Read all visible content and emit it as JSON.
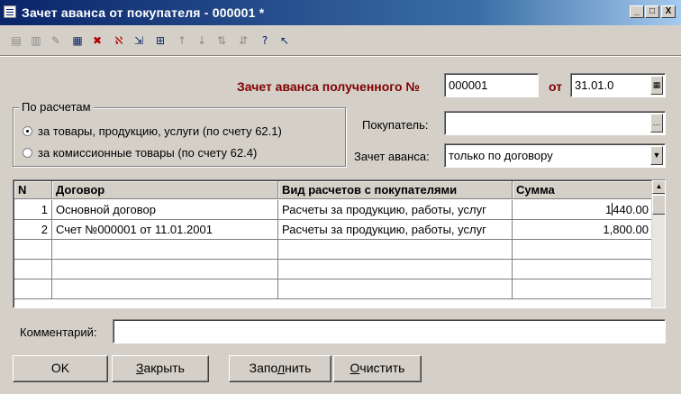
{
  "window": {
    "title": "Зачет аванса от покупателя - 000001 *",
    "controls": {
      "minimize": "_",
      "maximize": "□",
      "close": "X"
    }
  },
  "toolbar": {
    "icons": [
      "new-row-icon",
      "copy-row-icon",
      "edit-row-icon",
      "group-icon",
      "delete-row-icon",
      "delete-mark-icon",
      "move-icon",
      "outline-icon",
      "move-up-icon",
      "move-down-icon",
      "sort-asc-icon",
      "sort-desc-icon",
      "help-icon",
      "context-help-icon"
    ]
  },
  "header": {
    "doc_label": "Зачет аванса полученного №",
    "number": "000001",
    "date_label": "от",
    "date": "31.01.0"
  },
  "settlements": {
    "legend": "По расчетам",
    "options": [
      {
        "label": "за товары, продукцию, услуги (по счету 62.1)",
        "selected": true
      },
      {
        "label": "за комиссионные товары (по счету 62.4)",
        "selected": false
      }
    ]
  },
  "buyer": {
    "label": "Покупатель:",
    "value": ""
  },
  "advance": {
    "label": "Зачет аванса:",
    "value": "только по договору"
  },
  "table": {
    "columns": [
      "N",
      "Договор",
      "Вид расчетов с покупателями",
      "Сумма"
    ],
    "rows": [
      {
        "n": "1",
        "contract": "Основной договор",
        "kind": "Расчеты за продукцию, работы, услуг",
        "sum_a": "1",
        "sum_b": "440.00"
      },
      {
        "n": "2",
        "contract": "Счет №000001 от 11.01.2001",
        "kind": "Расчеты за продукцию, работы, услуг",
        "sum_a": "1,800.00",
        "sum_b": ""
      }
    ]
  },
  "comment": {
    "label": "Комментарий:",
    "value": ""
  },
  "buttons": {
    "ok": "OK",
    "close_u": "З",
    "close_rest": "акрыть",
    "fill_pre": "Запо",
    "fill_u": "л",
    "fill_post": "нить",
    "clear_u": "О",
    "clear_rest": "чистить"
  }
}
